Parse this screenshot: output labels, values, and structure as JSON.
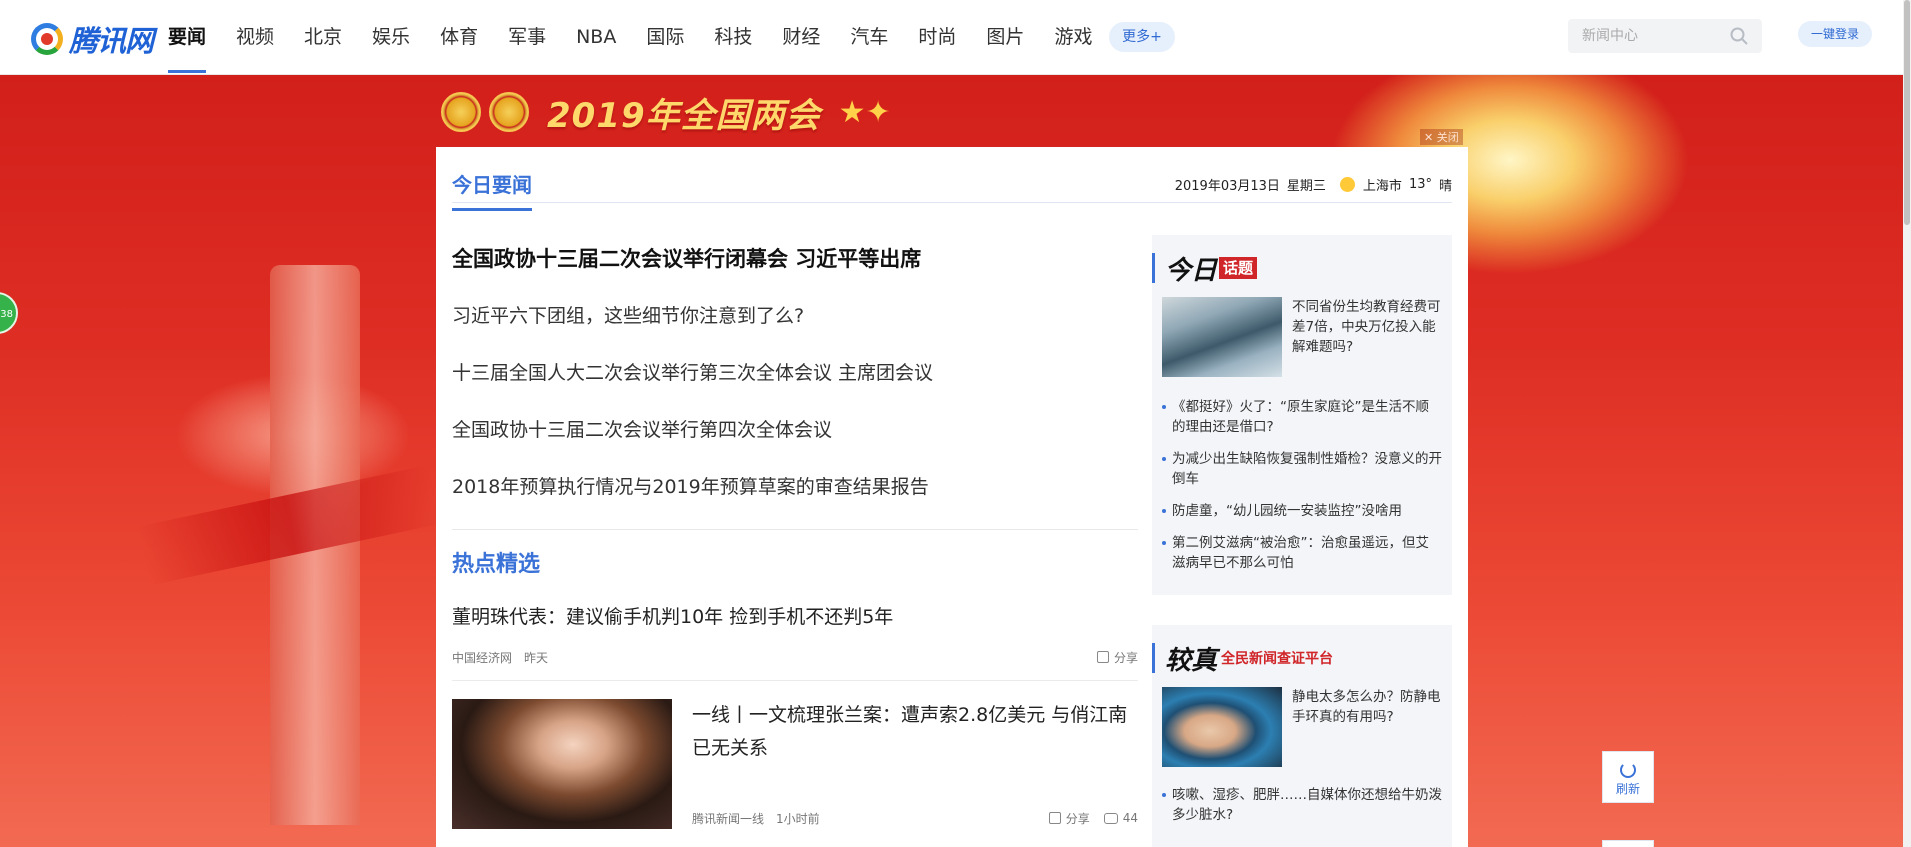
{
  "logo": {
    "text": "腾讯网"
  },
  "nav": {
    "items": [
      "要闻",
      "视频",
      "北京",
      "娱乐",
      "体育",
      "军事",
      "NBA",
      "国际",
      "科技",
      "财经",
      "汽车",
      "时尚",
      "图片",
      "游戏"
    ],
    "active": "要闻",
    "more": "更多+"
  },
  "search": {
    "placeholder": "新闻中心"
  },
  "login": {
    "label": "一键登录"
  },
  "banner": {
    "title": "2019年全国两会",
    "close": "✕ 关闭"
  },
  "side_badge": "38",
  "card": {
    "tab": "今日要闻",
    "date": "2019年03月13日",
    "weekday": "星期三",
    "city": "上海市",
    "temp": "13°",
    "weather": "晴"
  },
  "headlines": {
    "lead": "全国政协十三届二次会议举行闭幕会 习近平等出席",
    "links": [
      "习近平六下团组，这些细节你注意到了么?",
      "十三届全国人大二次会议举行第三次全体会议 主席团会议",
      "全国政协十三届二次会议举行第四次全体会议",
      "2018年预算执行情况与2019年预算草案的审查结果报告"
    ]
  },
  "hot": {
    "title": "热点精选",
    "item1": {
      "title": "董明珠代表：建议偷手机判10年 捡到手机不还判5年",
      "source": "中国经济网",
      "time": "昨天",
      "share": "分享"
    },
    "item2": {
      "title": "一线丨一文梳理张兰案：遭声索2.8亿美元 与俏江南已无关系",
      "source": "腾讯新闻一线",
      "time": "1小时前",
      "share": "分享",
      "comments": "44"
    }
  },
  "topic": {
    "head_big": "今日",
    "head_tag": "话题",
    "feature": "不同省份生均教育经费可差7倍，中央万亿投入能解难题吗?",
    "list": [
      "《都挺好》火了：“原生家庭论”是生活不顺的理由还是借口?",
      "为减少出生缺陷恢复强制性婚检？没意义的开倒车",
      "防虐童，“幼儿园统一安装监控”没啥用",
      "第二例艾滋病“被治愈”：治愈虽遥远，但艾滋病早已不那么可怕"
    ]
  },
  "check": {
    "head_big": "较真",
    "head_sub": "全民新闻查证平台",
    "feature": "静电太多怎么办？防静电手环真的有用吗?",
    "list": [
      "咳嗽、湿疹、肥胖……自媒体你还想给牛奶泼多少脏水?"
    ]
  },
  "refresh": {
    "label": "刷新"
  },
  "colors": {
    "accent": "#3a72d8",
    "banner_red": "#d21f1a",
    "gold": "#ffd86b"
  }
}
